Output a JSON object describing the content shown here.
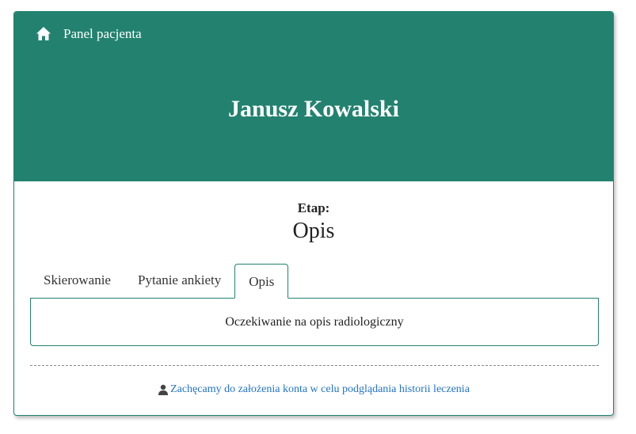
{
  "header": {
    "home_label": "Panel pacjenta",
    "home_icon": "home-icon",
    "patient_name": "Janusz Kowalski"
  },
  "stage": {
    "label": "Etap:",
    "value": "Opis"
  },
  "tabs": [
    {
      "label": "Skierowanie",
      "active": false
    },
    {
      "label": "Pytanie ankiety",
      "active": false
    },
    {
      "label": "Opis",
      "active": true
    }
  ],
  "tab_panel": {
    "text": "Oczekiwanie na opis radiologiczny"
  },
  "footer": {
    "account_icon": "user-icon",
    "account_link": "Zachęcamy do założenia konta w celu podglądania historii leczenia"
  },
  "colors": {
    "primary": "#23826f",
    "link": "#2273c9"
  }
}
